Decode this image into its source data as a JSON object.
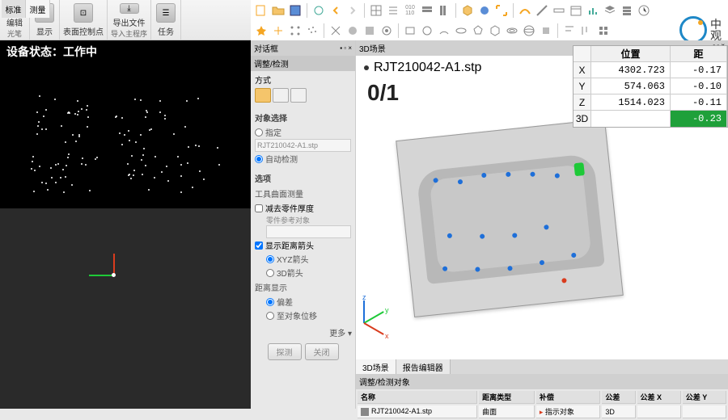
{
  "tabs": {
    "tab1": "标准",
    "tab2": "测量"
  },
  "ribbon": {
    "edit": "编辑",
    "show": "显示",
    "surface": "表面控制点",
    "export": "导出文件",
    "task": "任务",
    "sub1": "光笔",
    "sub2": "导入主程序"
  },
  "status": "设备状态：工作中",
  "panel": {
    "header": "对话框",
    "tab": "调整/检测",
    "mode_label": "方式",
    "obj_select": "对象选择",
    "specify": "指定",
    "specify_value": "RJT210042-A1.stp",
    "auto_detect": "自动检测",
    "options": "选项",
    "tool_surface": "工具曲面测量",
    "subtract_thickness": "减去零件厚度",
    "ref_obj_label": "零件参考对象",
    "show_arrows": "显示距离箭头",
    "xyz_arrow": "XYZ箭头",
    "three_d_arrow": "3D箭头",
    "dist_display": "距离显示",
    "deviation": "偏差",
    "to_obj_pos": "至对象位移",
    "more": "更多 ▾",
    "probe": "探测",
    "close": "关闭"
  },
  "scene": {
    "header": "3D场景",
    "filename": "RJT210042-A1.stp",
    "counter": "0/1",
    "tab_3d": "3D场景",
    "tab_report": "报告编辑器",
    "sub_tab": "调整/检测对象"
  },
  "coords": {
    "hdr_pos": "位置",
    "hdr_dist": "距",
    "x_lbl": "X",
    "x_pos": "4302.723",
    "x_dist": "-0.17",
    "y_lbl": "Y",
    "y_pos": "574.063",
    "y_dist": "-0.10",
    "z_lbl": "Z",
    "z_pos": "1514.023",
    "z_dist": "-0.11",
    "td_lbl": "3D",
    "td_dist": "-0.23"
  },
  "table": {
    "col_name": "名称",
    "col_dist_type": "距离类型",
    "col_comp": "补偿",
    "col_tol": "公差",
    "col_tol_x": "公差 X",
    "col_tol_y": "公差 Y",
    "row_name": "RJT210042-A1.stp",
    "row_dist_type": "曲面",
    "row_comp": "指示对象",
    "row_tol": "3D"
  },
  "axis": {
    "x": "x",
    "y": "y",
    "z": "z"
  },
  "logo": {
    "l1": "中",
    "l2": "观"
  }
}
